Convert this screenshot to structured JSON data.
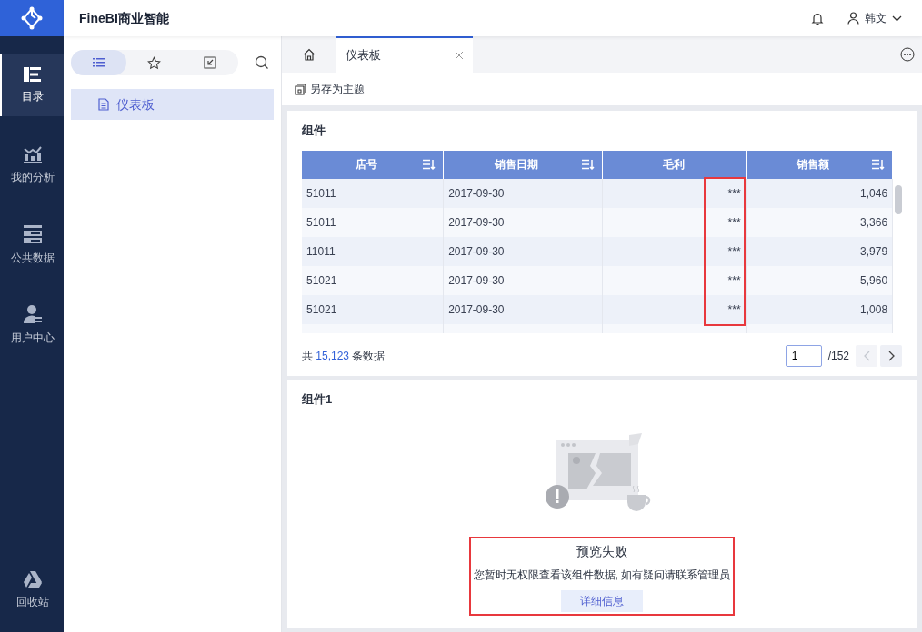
{
  "app": {
    "title": "FineBI商业智能",
    "user": "韩文"
  },
  "nav": [
    {
      "label": "目录",
      "selected": true
    },
    {
      "label": "我的分析",
      "selected": false
    },
    {
      "label": "公共数据",
      "selected": false
    },
    {
      "label": "用户中心",
      "selected": false
    }
  ],
  "nav_bottom": {
    "label": "回收站"
  },
  "sidebar": {
    "tabs": [
      {
        "selected": true
      },
      {
        "selected": false
      },
      {
        "selected": false
      }
    ],
    "items": [
      {
        "label": "仪表板",
        "selected": true
      }
    ]
  },
  "tabs": [
    {
      "label": "仪表板",
      "selected": true
    }
  ],
  "toolbar": {
    "save_theme": "另存为主题"
  },
  "widget": {
    "title": "组件",
    "columns": [
      {
        "label": "店号",
        "sortable": true,
        "highlighted": false
      },
      {
        "label": "销售日期",
        "sortable": true,
        "highlighted": false
      },
      {
        "label": "毛利",
        "sortable": false,
        "highlighted": true
      },
      {
        "label": "销售额",
        "sortable": true,
        "highlighted": false
      }
    ],
    "rows": [
      [
        "51011",
        "2017-09-30",
        "***",
        "1,046"
      ],
      [
        "51011",
        "2017-09-30",
        "***",
        "3,366"
      ],
      [
        "11011",
        "2017-09-30",
        "***",
        "3,979"
      ],
      [
        "51021",
        "2017-09-30",
        "***",
        "5,960"
      ],
      [
        "51021",
        "2017-09-30",
        "***",
        "1,008"
      ]
    ],
    "footer": {
      "prefix": "共",
      "count": "15,123",
      "suffix": "条数据",
      "page": "1",
      "total": "/152"
    }
  },
  "widget2": {
    "title": "组件1",
    "error_title": "预览失败",
    "error_message": "您暂时无权限查看该组件数据, 如有疑问请联系管理员",
    "details_button": "详细信息",
    "highlighted": true
  }
}
